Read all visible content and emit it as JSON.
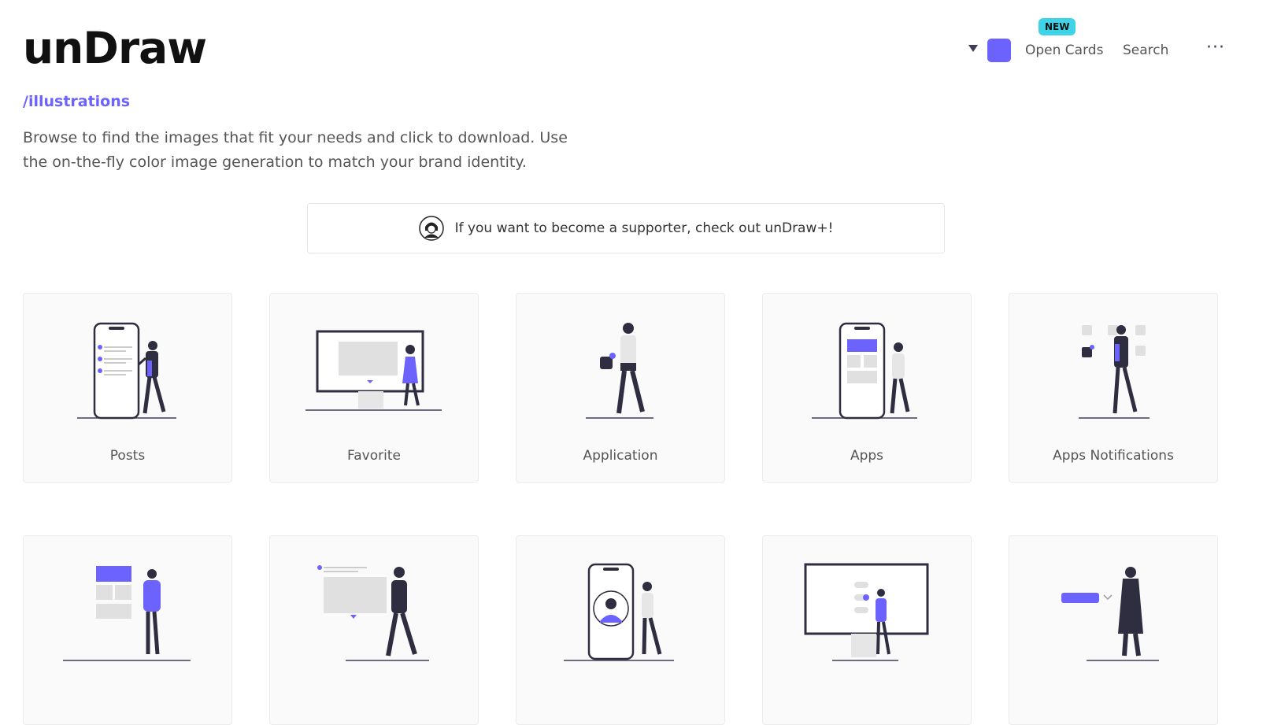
{
  "brand": {
    "logo": "unDraw",
    "section_link": "/illustrations",
    "accent": "#6c63ff"
  },
  "description": "Browse to find the images that fit your needs and click to download. Use the on-the-fly color image generation to match your brand identity.",
  "nav": {
    "color_dropdown_icon": "caret-down-icon",
    "color_value": "#6c63ff",
    "new_badge": "NEW",
    "new_badge_color": "#3ed3e6",
    "open_cards": "Open Cards",
    "search": "Search",
    "more_icon": "···"
  },
  "banner": {
    "icon": "supporter-avatar-icon",
    "text": "If you want to become a supporter, check out unDraw+!"
  },
  "cards": [
    {
      "label": "Posts",
      "illustration": "phone-posts-illustration"
    },
    {
      "label": "Favorite",
      "illustration": "monitor-favorite-illustration"
    },
    {
      "label": "Application",
      "illustration": "application-illustration"
    },
    {
      "label": "Apps",
      "illustration": "phone-apps-illustration"
    },
    {
      "label": "Apps Notifications",
      "illustration": "apps-notifications-illustration"
    },
    {
      "label": "",
      "illustration": "layout-person-illustration"
    },
    {
      "label": "",
      "illustration": "comment-card-illustration"
    },
    {
      "label": "",
      "illustration": "phone-profile-illustration"
    },
    {
      "label": "",
      "illustration": "monitor-toggles-illustration"
    },
    {
      "label": "",
      "illustration": "dropdown-person-illustration"
    }
  ]
}
